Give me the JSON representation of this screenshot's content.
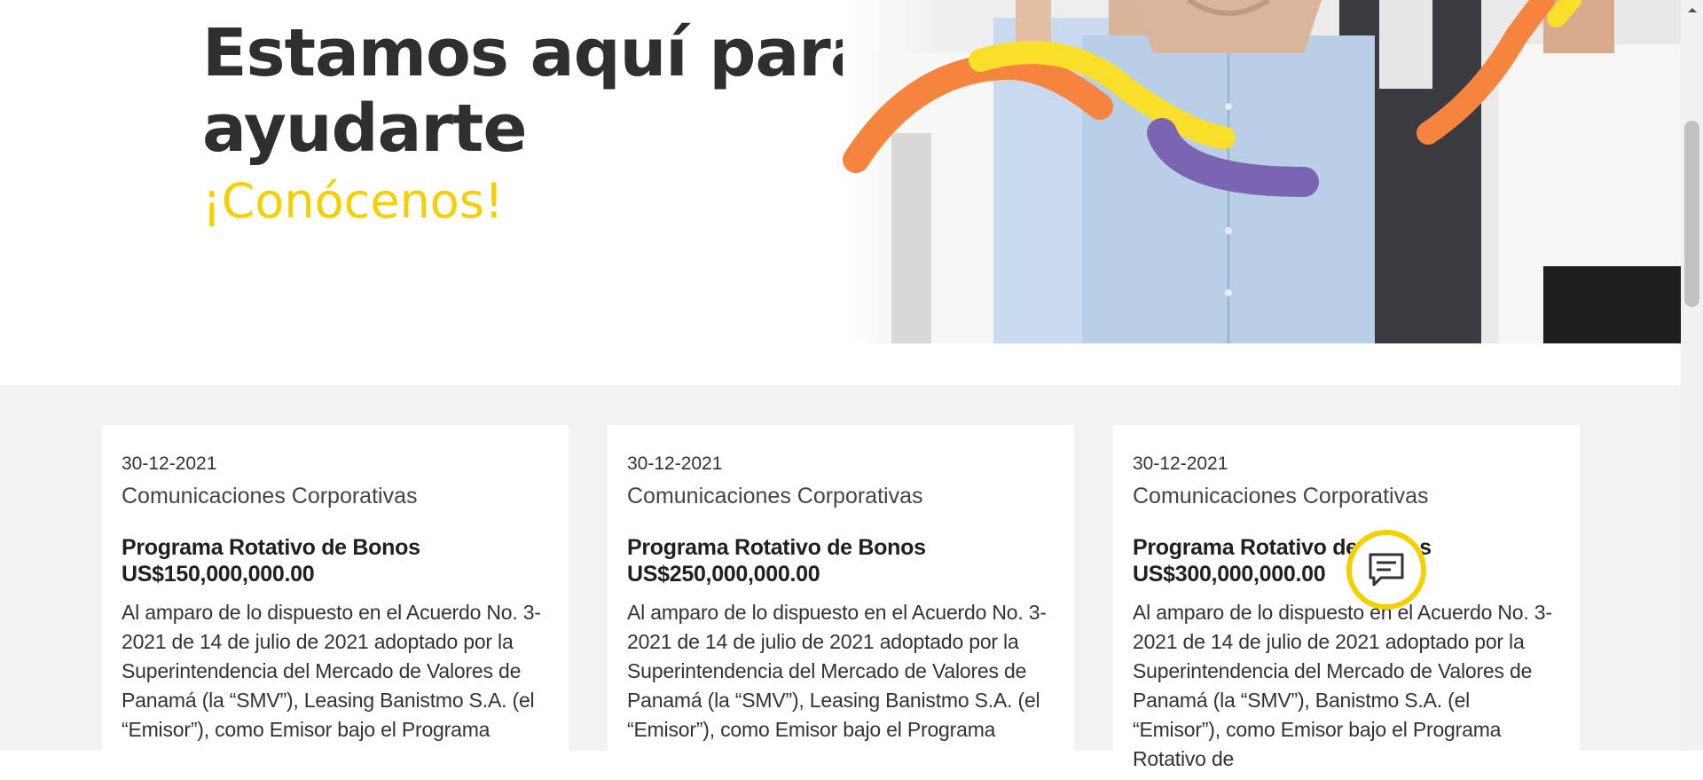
{
  "hero": {
    "title_line1": "Estamos aquí para",
    "title_line2": "ayudarte",
    "subtitle": "¡Conócenos!",
    "image": "people-team-photo"
  },
  "cards": [
    {
      "date": "30-12-2021",
      "category": "Comunicaciones Corporativas",
      "title_line1": "Programa Rotativo de Bonos",
      "title_line2": "US$150,000,000.00",
      "body": "Al amparo de lo dispuesto en el Acuerdo No. 3-2021 de 14 de julio de 2021 adoptado por la Superintendencia del Mercado de Valores de Panamá (la “SMV”), Leasing Banistmo S.A. (el “Emisor”), como Emisor bajo el Programa"
    },
    {
      "date": "30-12-2021",
      "category": "Comunicaciones Corporativas",
      "title_line1": "Programa Rotativo de Bonos",
      "title_line2": "US$250,000,000.00",
      "body": "Al amparo de lo dispuesto en el Acuerdo No. 3-2021 de 14 de julio de 2021 adoptado por la Superintendencia del Mercado de Valores de Panamá (la “SMV”), Leasing Banistmo S.A. (el “Emisor”), como Emisor bajo el Programa"
    },
    {
      "date": "30-12-2021",
      "category": "Comunicaciones Corporativas",
      "title_line1": "Programa Rotativo de Bonos",
      "title_line2": "US$300,000,000.00",
      "body": "Al amparo de lo dispuesto en el Acuerdo No. 3-2021 de 14 de julio de 2021 adoptado por la Superintendencia del Mercado de Valores de Panamá (la “SMV”), Banistmo S.A. (el “Emisor”), como Emisor bajo el Programa Rotativo de"
    }
  ],
  "chat": {
    "icon": "chat-bubble-icon"
  },
  "colors": {
    "accent_yellow": "#f4d000",
    "accent_orange": "#f5843f",
    "accent_purple": "#7b64b1",
    "section_bg": "#f2f2f2"
  }
}
